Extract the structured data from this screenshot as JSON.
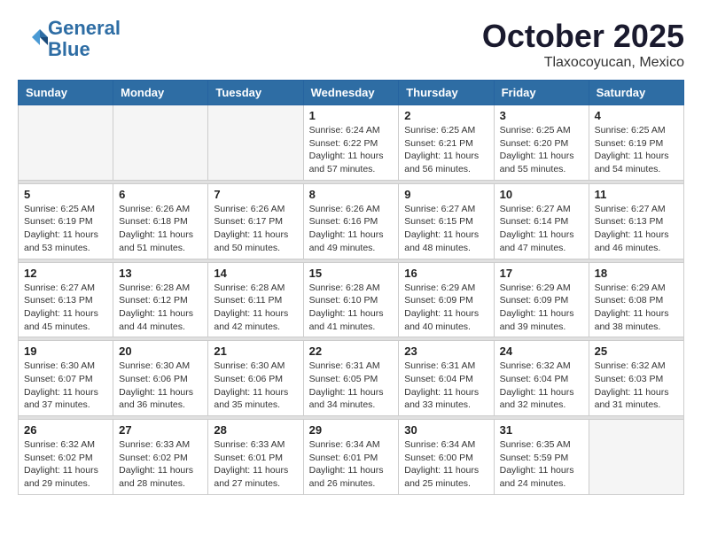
{
  "logo": {
    "line1": "General",
    "line2": "Blue"
  },
  "title": "October 2025",
  "location": "Tlaxocoyucan, Mexico",
  "weekdays": [
    "Sunday",
    "Monday",
    "Tuesday",
    "Wednesday",
    "Thursday",
    "Friday",
    "Saturday"
  ],
  "weeks": [
    [
      {
        "day": "",
        "info": ""
      },
      {
        "day": "",
        "info": ""
      },
      {
        "day": "",
        "info": ""
      },
      {
        "day": "1",
        "info": "Sunrise: 6:24 AM\nSunset: 6:22 PM\nDaylight: 11 hours\nand 57 minutes."
      },
      {
        "day": "2",
        "info": "Sunrise: 6:25 AM\nSunset: 6:21 PM\nDaylight: 11 hours\nand 56 minutes."
      },
      {
        "day": "3",
        "info": "Sunrise: 6:25 AM\nSunset: 6:20 PM\nDaylight: 11 hours\nand 55 minutes."
      },
      {
        "day": "4",
        "info": "Sunrise: 6:25 AM\nSunset: 6:19 PM\nDaylight: 11 hours\nand 54 minutes."
      }
    ],
    [
      {
        "day": "5",
        "info": "Sunrise: 6:25 AM\nSunset: 6:19 PM\nDaylight: 11 hours\nand 53 minutes."
      },
      {
        "day": "6",
        "info": "Sunrise: 6:26 AM\nSunset: 6:18 PM\nDaylight: 11 hours\nand 51 minutes."
      },
      {
        "day": "7",
        "info": "Sunrise: 6:26 AM\nSunset: 6:17 PM\nDaylight: 11 hours\nand 50 minutes."
      },
      {
        "day": "8",
        "info": "Sunrise: 6:26 AM\nSunset: 6:16 PM\nDaylight: 11 hours\nand 49 minutes."
      },
      {
        "day": "9",
        "info": "Sunrise: 6:27 AM\nSunset: 6:15 PM\nDaylight: 11 hours\nand 48 minutes."
      },
      {
        "day": "10",
        "info": "Sunrise: 6:27 AM\nSunset: 6:14 PM\nDaylight: 11 hours\nand 47 minutes."
      },
      {
        "day": "11",
        "info": "Sunrise: 6:27 AM\nSunset: 6:13 PM\nDaylight: 11 hours\nand 46 minutes."
      }
    ],
    [
      {
        "day": "12",
        "info": "Sunrise: 6:27 AM\nSunset: 6:13 PM\nDaylight: 11 hours\nand 45 minutes."
      },
      {
        "day": "13",
        "info": "Sunrise: 6:28 AM\nSunset: 6:12 PM\nDaylight: 11 hours\nand 44 minutes."
      },
      {
        "day": "14",
        "info": "Sunrise: 6:28 AM\nSunset: 6:11 PM\nDaylight: 11 hours\nand 42 minutes."
      },
      {
        "day": "15",
        "info": "Sunrise: 6:28 AM\nSunset: 6:10 PM\nDaylight: 11 hours\nand 41 minutes."
      },
      {
        "day": "16",
        "info": "Sunrise: 6:29 AM\nSunset: 6:09 PM\nDaylight: 11 hours\nand 40 minutes."
      },
      {
        "day": "17",
        "info": "Sunrise: 6:29 AM\nSunset: 6:09 PM\nDaylight: 11 hours\nand 39 minutes."
      },
      {
        "day": "18",
        "info": "Sunrise: 6:29 AM\nSunset: 6:08 PM\nDaylight: 11 hours\nand 38 minutes."
      }
    ],
    [
      {
        "day": "19",
        "info": "Sunrise: 6:30 AM\nSunset: 6:07 PM\nDaylight: 11 hours\nand 37 minutes."
      },
      {
        "day": "20",
        "info": "Sunrise: 6:30 AM\nSunset: 6:06 PM\nDaylight: 11 hours\nand 36 minutes."
      },
      {
        "day": "21",
        "info": "Sunrise: 6:30 AM\nSunset: 6:06 PM\nDaylight: 11 hours\nand 35 minutes."
      },
      {
        "day": "22",
        "info": "Sunrise: 6:31 AM\nSunset: 6:05 PM\nDaylight: 11 hours\nand 34 minutes."
      },
      {
        "day": "23",
        "info": "Sunrise: 6:31 AM\nSunset: 6:04 PM\nDaylight: 11 hours\nand 33 minutes."
      },
      {
        "day": "24",
        "info": "Sunrise: 6:32 AM\nSunset: 6:04 PM\nDaylight: 11 hours\nand 32 minutes."
      },
      {
        "day": "25",
        "info": "Sunrise: 6:32 AM\nSunset: 6:03 PM\nDaylight: 11 hours\nand 31 minutes."
      }
    ],
    [
      {
        "day": "26",
        "info": "Sunrise: 6:32 AM\nSunset: 6:02 PM\nDaylight: 11 hours\nand 29 minutes."
      },
      {
        "day": "27",
        "info": "Sunrise: 6:33 AM\nSunset: 6:02 PM\nDaylight: 11 hours\nand 28 minutes."
      },
      {
        "day": "28",
        "info": "Sunrise: 6:33 AM\nSunset: 6:01 PM\nDaylight: 11 hours\nand 27 minutes."
      },
      {
        "day": "29",
        "info": "Sunrise: 6:34 AM\nSunset: 6:01 PM\nDaylight: 11 hours\nand 26 minutes."
      },
      {
        "day": "30",
        "info": "Sunrise: 6:34 AM\nSunset: 6:00 PM\nDaylight: 11 hours\nand 25 minutes."
      },
      {
        "day": "31",
        "info": "Sunrise: 6:35 AM\nSunset: 5:59 PM\nDaylight: 11 hours\nand 24 minutes."
      },
      {
        "day": "",
        "info": ""
      }
    ]
  ]
}
